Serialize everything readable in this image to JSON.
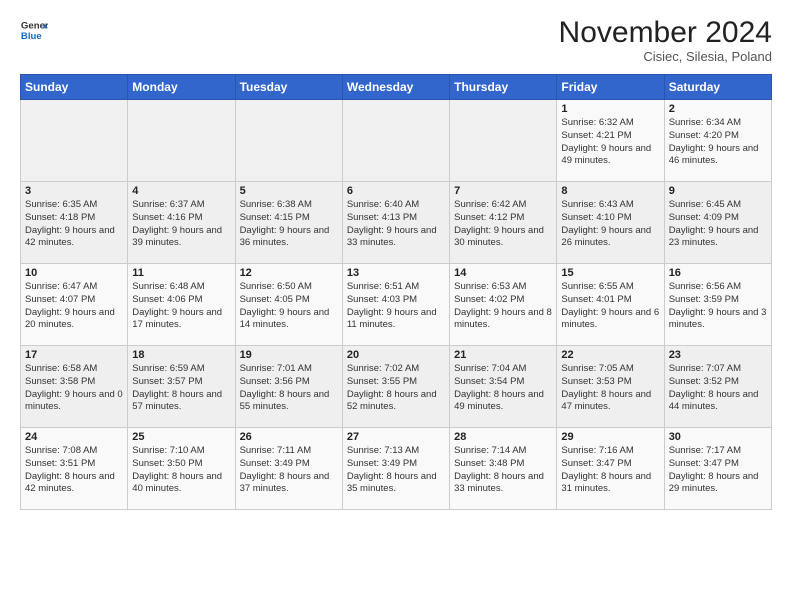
{
  "header": {
    "logo_general": "General",
    "logo_blue": "Blue",
    "month_title": "November 2024",
    "location": "Cisiec, Silesia, Poland"
  },
  "days_of_week": [
    "Sunday",
    "Monday",
    "Tuesday",
    "Wednesday",
    "Thursday",
    "Friday",
    "Saturday"
  ],
  "weeks": [
    [
      {
        "day": "",
        "info": ""
      },
      {
        "day": "",
        "info": ""
      },
      {
        "day": "",
        "info": ""
      },
      {
        "day": "",
        "info": ""
      },
      {
        "day": "",
        "info": ""
      },
      {
        "day": "1",
        "info": "Sunrise: 6:32 AM\nSunset: 4:21 PM\nDaylight: 9 hours\nand 49 minutes."
      },
      {
        "day": "2",
        "info": "Sunrise: 6:34 AM\nSunset: 4:20 PM\nDaylight: 9 hours\nand 46 minutes."
      }
    ],
    [
      {
        "day": "3",
        "info": "Sunrise: 6:35 AM\nSunset: 4:18 PM\nDaylight: 9 hours\nand 42 minutes."
      },
      {
        "day": "4",
        "info": "Sunrise: 6:37 AM\nSunset: 4:16 PM\nDaylight: 9 hours\nand 39 minutes."
      },
      {
        "day": "5",
        "info": "Sunrise: 6:38 AM\nSunset: 4:15 PM\nDaylight: 9 hours\nand 36 minutes."
      },
      {
        "day": "6",
        "info": "Sunrise: 6:40 AM\nSunset: 4:13 PM\nDaylight: 9 hours\nand 33 minutes."
      },
      {
        "day": "7",
        "info": "Sunrise: 6:42 AM\nSunset: 4:12 PM\nDaylight: 9 hours\nand 30 minutes."
      },
      {
        "day": "8",
        "info": "Sunrise: 6:43 AM\nSunset: 4:10 PM\nDaylight: 9 hours\nand 26 minutes."
      },
      {
        "day": "9",
        "info": "Sunrise: 6:45 AM\nSunset: 4:09 PM\nDaylight: 9 hours\nand 23 minutes."
      }
    ],
    [
      {
        "day": "10",
        "info": "Sunrise: 6:47 AM\nSunset: 4:07 PM\nDaylight: 9 hours\nand 20 minutes."
      },
      {
        "day": "11",
        "info": "Sunrise: 6:48 AM\nSunset: 4:06 PM\nDaylight: 9 hours\nand 17 minutes."
      },
      {
        "day": "12",
        "info": "Sunrise: 6:50 AM\nSunset: 4:05 PM\nDaylight: 9 hours\nand 14 minutes."
      },
      {
        "day": "13",
        "info": "Sunrise: 6:51 AM\nSunset: 4:03 PM\nDaylight: 9 hours\nand 11 minutes."
      },
      {
        "day": "14",
        "info": "Sunrise: 6:53 AM\nSunset: 4:02 PM\nDaylight: 9 hours\nand 8 minutes."
      },
      {
        "day": "15",
        "info": "Sunrise: 6:55 AM\nSunset: 4:01 PM\nDaylight: 9 hours\nand 6 minutes."
      },
      {
        "day": "16",
        "info": "Sunrise: 6:56 AM\nSunset: 3:59 PM\nDaylight: 9 hours\nand 3 minutes."
      }
    ],
    [
      {
        "day": "17",
        "info": "Sunrise: 6:58 AM\nSunset: 3:58 PM\nDaylight: 9 hours\nand 0 minutes."
      },
      {
        "day": "18",
        "info": "Sunrise: 6:59 AM\nSunset: 3:57 PM\nDaylight: 8 hours\nand 57 minutes."
      },
      {
        "day": "19",
        "info": "Sunrise: 7:01 AM\nSunset: 3:56 PM\nDaylight: 8 hours\nand 55 minutes."
      },
      {
        "day": "20",
        "info": "Sunrise: 7:02 AM\nSunset: 3:55 PM\nDaylight: 8 hours\nand 52 minutes."
      },
      {
        "day": "21",
        "info": "Sunrise: 7:04 AM\nSunset: 3:54 PM\nDaylight: 8 hours\nand 49 minutes."
      },
      {
        "day": "22",
        "info": "Sunrise: 7:05 AM\nSunset: 3:53 PM\nDaylight: 8 hours\nand 47 minutes."
      },
      {
        "day": "23",
        "info": "Sunrise: 7:07 AM\nSunset: 3:52 PM\nDaylight: 8 hours\nand 44 minutes."
      }
    ],
    [
      {
        "day": "24",
        "info": "Sunrise: 7:08 AM\nSunset: 3:51 PM\nDaylight: 8 hours\nand 42 minutes."
      },
      {
        "day": "25",
        "info": "Sunrise: 7:10 AM\nSunset: 3:50 PM\nDaylight: 8 hours\nand 40 minutes."
      },
      {
        "day": "26",
        "info": "Sunrise: 7:11 AM\nSunset: 3:49 PM\nDaylight: 8 hours\nand 37 minutes."
      },
      {
        "day": "27",
        "info": "Sunrise: 7:13 AM\nSunset: 3:49 PM\nDaylight: 8 hours\nand 35 minutes."
      },
      {
        "day": "28",
        "info": "Sunrise: 7:14 AM\nSunset: 3:48 PM\nDaylight: 8 hours\nand 33 minutes."
      },
      {
        "day": "29",
        "info": "Sunrise: 7:16 AM\nSunset: 3:47 PM\nDaylight: 8 hours\nand 31 minutes."
      },
      {
        "day": "30",
        "info": "Sunrise: 7:17 AM\nSunset: 3:47 PM\nDaylight: 8 hours\nand 29 minutes."
      }
    ]
  ]
}
